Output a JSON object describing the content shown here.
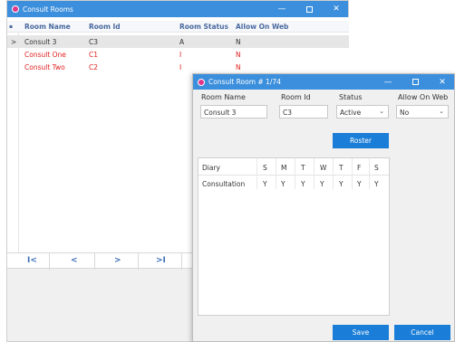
{
  "rooms_window": {
    "title": "Consult Rooms",
    "columns": [
      "Room Name",
      "Room Id",
      "Room Status",
      "Allow On Web"
    ],
    "sort_indicator": "▪",
    "rows": [
      {
        "marker": ">",
        "name": "Consult 3",
        "id": "C3",
        "status": "A",
        "web": "N"
      },
      {
        "marker": "",
        "name": "Consult One",
        "id": "C1",
        "status": "I",
        "web": "N"
      },
      {
        "marker": "",
        "name": "Consult Two",
        "id": "C2",
        "status": "I",
        "web": "N"
      }
    ],
    "pager": {
      "first": "I<",
      "prev": "<",
      "next": ">",
      "last": ">I"
    },
    "colors": {
      "titlebar": "#3c8fdc",
      "inactive_text": "#e02020",
      "header_text": "#4a6aa0"
    }
  },
  "room_dialog": {
    "title": "Consult Room # 1/74",
    "fields": {
      "room_name": {
        "label": "Room Name",
        "value": "Consult 3"
      },
      "room_id": {
        "label": "Room Id",
        "value": "C3"
      },
      "status": {
        "label": "Status",
        "value": "Active"
      },
      "allow_on_web": {
        "label": "Allow On Web",
        "value": "No"
      }
    },
    "roster_label": "Roster",
    "diary": {
      "headers": [
        "Diary",
        "S",
        "M",
        "T",
        "W",
        "T",
        "F",
        "S"
      ],
      "rows": [
        [
          "Consultation",
          "Y",
          "Y",
          "Y",
          "Y",
          "Y",
          "Y",
          "Y"
        ]
      ]
    },
    "save_label": "Save",
    "cancel_label": "Cancel",
    "colors": {
      "button": "#1a7dd7"
    }
  },
  "window_controls": {
    "minimize": "—",
    "close": "✕"
  }
}
